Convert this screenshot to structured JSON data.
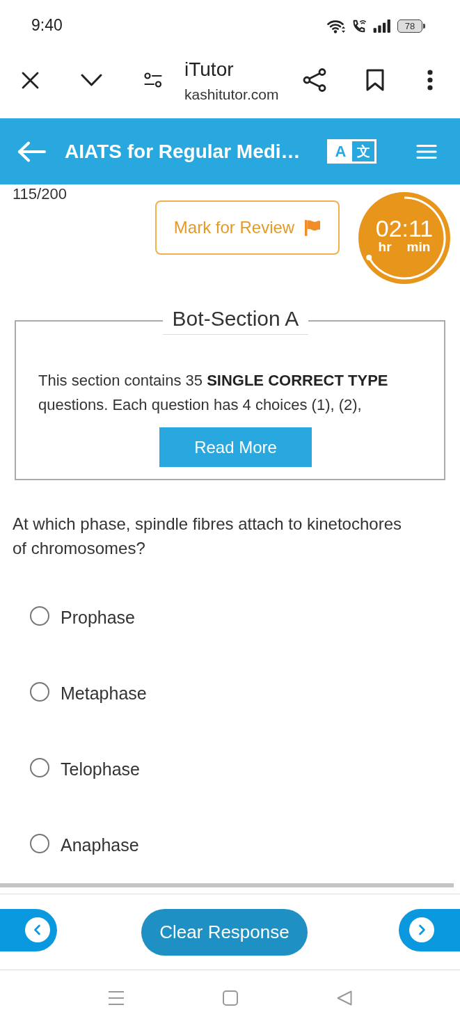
{
  "status_bar": {
    "time": "9:40",
    "battery": "78"
  },
  "browser_bar": {
    "title": "iTutor",
    "url": "kashitutor.com"
  },
  "header": {
    "title": "AIATS for Regular Medi…",
    "translate_glyphs": [
      "A",
      "文"
    ]
  },
  "question_counter": "115/200",
  "mark_for_review": {
    "label": "Mark for Review"
  },
  "timer": {
    "time": "02:11",
    "units": [
      "hr",
      "min"
    ]
  },
  "section": {
    "title": "Bot-Section A",
    "description": "This section contains 35 **SINGLE CORRECT TYPE** questions. Each question has 4 choices (1), (2),",
    "button": "Read More"
  },
  "question": {
    "text": "At which phase, spindle fibres attach to kinetochores of chromosomes?",
    "options": [
      {
        "label": "Prophase",
        "selected": false
      },
      {
        "label": "Metaphase",
        "selected": false
      },
      {
        "label": "Telophase",
        "selected": false
      },
      {
        "label": "Anaphase",
        "selected": false
      }
    ]
  },
  "footer": {
    "clear_button": "Clear Response"
  }
}
